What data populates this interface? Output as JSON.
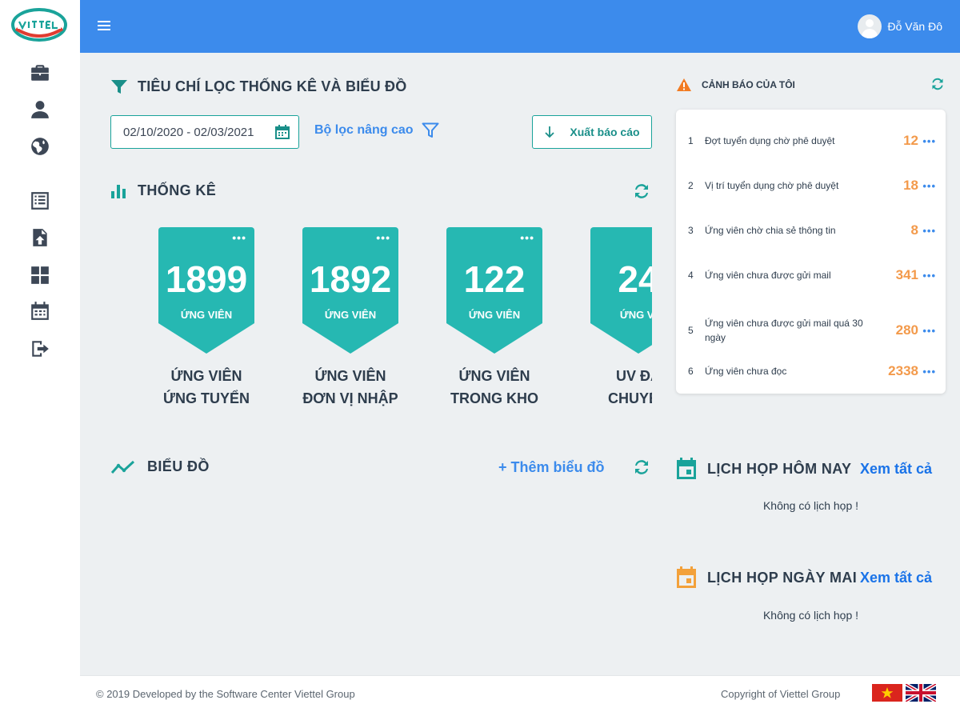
{
  "header": {
    "user_name": "Đỗ Văn Đô"
  },
  "sidebar": {
    "items": [
      {
        "icon": "briefcase-icon"
      },
      {
        "icon": "user-icon"
      },
      {
        "icon": "globe-icon"
      },
      {
        "icon": "list-icon"
      },
      {
        "icon": "file-upload-icon"
      },
      {
        "icon": "dashboard-grid-icon"
      },
      {
        "icon": "calendar-icon"
      },
      {
        "icon": "logout-icon"
      }
    ]
  },
  "filter": {
    "title": "TIÊU CHÍ LỌC THỐNG KÊ VÀ BIỂU ĐỒ",
    "date_range": "02/10/2020 - 02/03/2021",
    "advanced_label": "Bộ lọc nâng cao",
    "export_label": "Xuất báo cáo"
  },
  "stats": {
    "title": "THỐNG KÊ",
    "cards": [
      {
        "value": "1899",
        "unit": "ỨNG VIÊN",
        "label_line1": "ỨNG VIÊN",
        "label_line2": "ỨNG TUYỂN"
      },
      {
        "value": "1892",
        "unit": "ỨNG VIÊN",
        "label_line1": "ỨNG VIÊN",
        "label_line2": "ĐƠN VỊ NHẬP"
      },
      {
        "value": "122",
        "unit": "ỨNG VIÊN",
        "label_line1": "ỨNG VIÊN",
        "label_line2": "TRONG KHO"
      },
      {
        "value": "24",
        "unit": "ỨNG VI",
        "label_line1": "UV ĐÃ",
        "label_line2": "CHUYỂN"
      }
    ]
  },
  "charts": {
    "title": "BIỂU ĐỒ",
    "add_label": "+ Thêm biểu đồ"
  },
  "warnings": {
    "title": "CẢNH BÁO CỦA TÔI",
    "items": [
      {
        "index": "1",
        "text": "Đợt tuyển dụng chờ phê duyệt",
        "count": "12"
      },
      {
        "index": "2",
        "text": "Vị trí tuyển dụng chờ phê duyệt",
        "count": "18"
      },
      {
        "index": "3",
        "text": "Ứng viên chờ chia sẻ thông tin",
        "count": "8"
      },
      {
        "index": "4",
        "text": "Ứng viên chưa được gửi mail",
        "count": "341"
      },
      {
        "index": "5",
        "text": "Ứng viên chưa được gửi mail quá 30 ngày",
        "count": "280"
      },
      {
        "index": "6",
        "text": "Ứng viên chưa đọc",
        "count": "2338"
      }
    ]
  },
  "meetings": {
    "today_title": "LỊCH HỌP HÔM NAY",
    "today_see_all": "Xem tất cả",
    "today_empty": "Không có lịch họp !",
    "tomorrow_title": "LỊCH HỌP NGÀY MAI",
    "tomorrow_see_all": "Xem tất cả",
    "tomorrow_empty": "Không có lịch họp !"
  },
  "footer": {
    "left": "© 2019 Developed by the Software Center Viettel Group",
    "right": "Copyright of Viettel Group"
  },
  "colors": {
    "header_bg": "#3c8bec",
    "teal": "#26b8b2",
    "orange": "#f39a4b",
    "link_blue": "#1a73e8"
  }
}
